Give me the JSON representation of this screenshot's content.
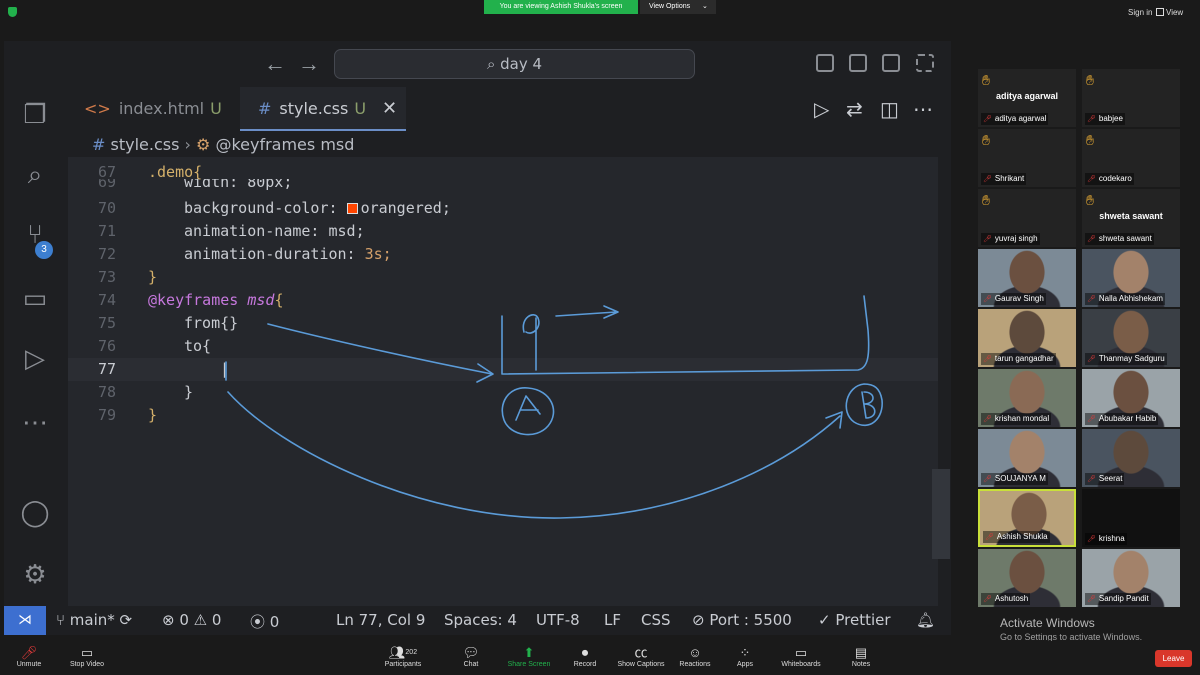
{
  "zoom": {
    "banner": "You are viewing Ashish Shukla's screen",
    "view_options": "View Options",
    "sign_in": "Sign in",
    "view": "View"
  },
  "vscode": {
    "search": "day 4",
    "badge": "3",
    "tabs": [
      {
        "name": "index.html",
        "status": "U"
      },
      {
        "name": "style.css",
        "status": "U"
      }
    ],
    "breadcrumb": {
      "file": "style.css",
      "symbol": "@keyframes msd"
    },
    "lines": [
      {
        "n": "67",
        "text": ".demo{"
      },
      {
        "n": "69",
        "text": "width: 80px;"
      },
      {
        "n": "70",
        "prop": "background-color:",
        "val": "orangered;"
      },
      {
        "n": "71",
        "prop": "animation-name:",
        "val": "msd;"
      },
      {
        "n": "72",
        "prop": "animation-duration:",
        "val": "3s;"
      },
      {
        "n": "73",
        "text": "}"
      },
      {
        "n": "74",
        "kw": "@keyframes",
        "name": "msd",
        "brace": "{"
      },
      {
        "n": "75",
        "text": "from{}"
      },
      {
        "n": "76",
        "text": "to{"
      },
      {
        "n": "77",
        "text": ""
      },
      {
        "n": "78",
        "text": "}"
      },
      {
        "n": "79",
        "text": "}"
      }
    ],
    "status": {
      "branch": "main*",
      "errors": "0",
      "warnings": "0",
      "ports": "0",
      "position": "Ln 77, Col 9",
      "spaces": "Spaces: 4",
      "encoding": "UTF-8",
      "eol": "LF",
      "language": "CSS",
      "port": "Port : 5500",
      "formatter": "Prettier"
    }
  },
  "participants": [
    {
      "name": "aditya agarwal",
      "display": "aditya agarwal",
      "hand": true
    },
    {
      "name": "babjee",
      "hand": true
    },
    {
      "name": "Shrikant",
      "hand": true
    },
    {
      "name": "codekaro",
      "hand": true
    },
    {
      "name": "yuvraj singh",
      "hand": true
    },
    {
      "name": "shweta sawant",
      "display": "shweta sawant",
      "hand": true
    },
    {
      "name": "Gaurav Singh"
    },
    {
      "name": "Nalla Abhishekam"
    },
    {
      "name": "tarun gangadhar"
    },
    {
      "name": "Thanmay Sadguru"
    },
    {
      "name": "krishan mondal"
    },
    {
      "name": "Abubakar Habib"
    },
    {
      "name": "SOUJANYA M"
    },
    {
      "name": "Seerat"
    },
    {
      "name": "Ashish Shukla",
      "active": true
    },
    {
      "name": "krishna"
    },
    {
      "name": "Ashutosh"
    },
    {
      "name": "Sandip Pandit"
    }
  ],
  "windows_watermark": {
    "title": "Activate Windows",
    "subtitle": "Go to Settings to activate Windows."
  },
  "toolbar": {
    "unmute": "Unmute",
    "stop_video": "Stop Video",
    "participants": "Participants",
    "participant_count": "202",
    "chat": "Chat",
    "share_screen": "Share Screen",
    "record": "Record",
    "show_captions": "Show Captions",
    "reactions": "Reactions",
    "apps": "Apps",
    "whiteboards": "Whiteboards",
    "notes": "Notes",
    "leave": "Leave"
  },
  "colors": {
    "accent_green": "#22b14c",
    "vscode_blue": "#3d6fd0",
    "ink": "#5b9bd8",
    "leave_red": "#d9372b"
  }
}
